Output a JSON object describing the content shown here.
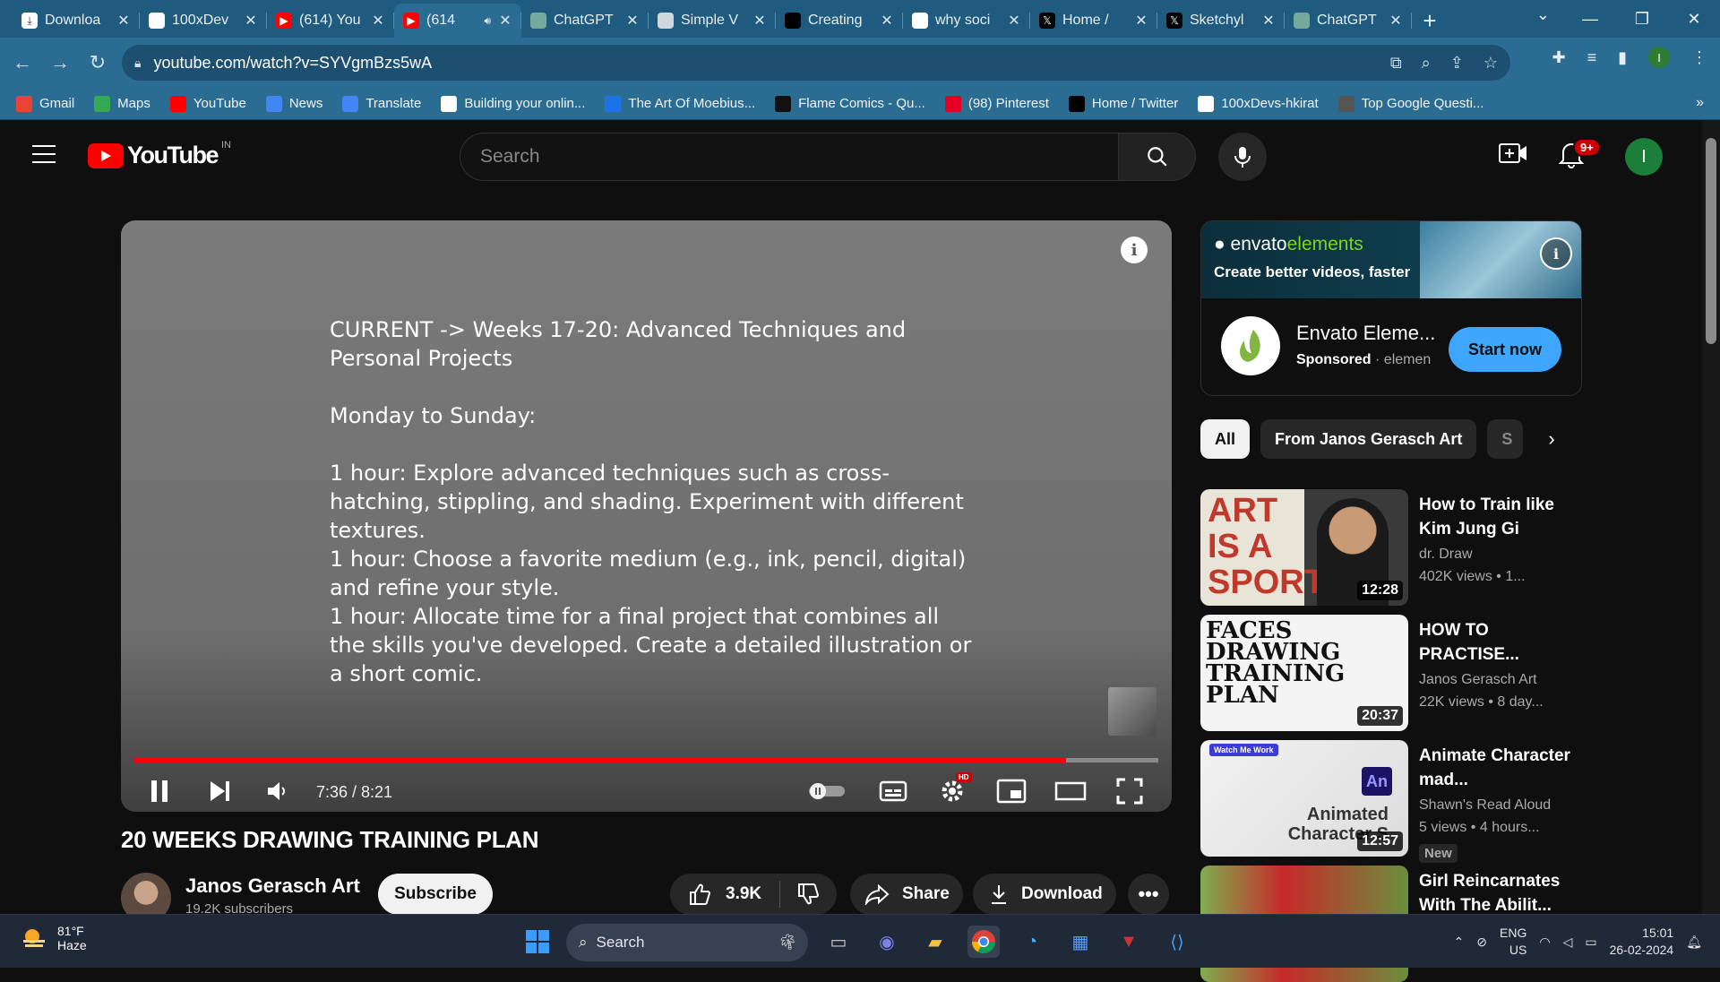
{
  "browser": {
    "tabs": [
      {
        "label": "Downloa",
        "icon": "download-icon"
      },
      {
        "label": "100xDev",
        "icon": "github-icon"
      },
      {
        "label": "(614) You",
        "icon": "youtube-icon"
      },
      {
        "label": "(614",
        "icon": "youtube-icon",
        "active": true
      },
      {
        "label": "ChatGPT",
        "icon": "chatgpt-icon"
      },
      {
        "label": "Simple V",
        "icon": "globe-icon"
      },
      {
        "label": "Creating",
        "icon": "medium-icon"
      },
      {
        "label": "why soci",
        "icon": "google-icon"
      },
      {
        "label": "Home / ",
        "icon": "x-icon"
      },
      {
        "label": "Sketchyl",
        "icon": "x-icon"
      },
      {
        "label": "ChatGPT",
        "icon": "chatgpt-icon"
      }
    ],
    "url": "youtube.com/watch?v=SYVgmBzs5wA",
    "bookmarks": [
      {
        "label": "Gmail",
        "icon": "gmail-icon"
      },
      {
        "label": "Maps",
        "icon": "maps-icon"
      },
      {
        "label": "YouTube",
        "icon": "youtube-icon"
      },
      {
        "label": "News",
        "icon": "news-icon"
      },
      {
        "label": "Translate",
        "icon": "translate-icon"
      },
      {
        "label": "Building your onlin...",
        "icon": "google-icon"
      },
      {
        "label": "The Art Of Moebius...",
        "icon": "shield-icon"
      },
      {
        "label": "Flame Comics - Qu...",
        "icon": "flame-icon"
      },
      {
        "label": "(98) Pinterest",
        "icon": "pinterest-icon"
      },
      {
        "label": "Home / Twitter",
        "icon": "x-icon"
      },
      {
        "label": "100xDevs-hkirat",
        "icon": "github-icon"
      },
      {
        "label": "Top Google Questi...",
        "icon": "bookmark-icon"
      }
    ],
    "bookmarks_more": "»",
    "profile_initial": "I"
  },
  "youtube": {
    "logo_text": "YouTube",
    "country": "IN",
    "search_placeholder": "Search",
    "notif_count": "9+",
    "avatar_initial": "I"
  },
  "player": {
    "slide_text": "CURRENT -> Weeks 17-20: Advanced Techniques and Personal Projects\n\nMonday to Sunday:\n\n1 hour: Explore advanced techniques such as cross-hatching, stippling, and shading. Experiment with different textures.\n1 hour: Choose a favorite medium (e.g., ink, pencil, digital) and refine your style.\n1 hour: Allocate time for a final project that combines all the skills you've developed. Create a detailed illustration or a short comic.",
    "time_display": "7:36 / 8:21",
    "progress_fraction": 0.91,
    "info_icon": "i",
    "hd_badge": "HD"
  },
  "video": {
    "title": "20 WEEKS DRAWING TRAINING PLAN",
    "channel": "Janos Gerasch Art",
    "subscribers": "19.2K subscribers",
    "subscribe_label": "Subscribe",
    "likes": "3.9K",
    "share_label": "Share",
    "download_label": "Download"
  },
  "ad": {
    "brand": "envato",
    "brand_suffix": "elements",
    "tagline": "Create better videos, faster",
    "name": "Envato Eleme...",
    "sponsored": "Sponsored",
    "domain": "· elemen",
    "cta": "Start now"
  },
  "chips": [
    "All",
    "From Janos Gerasch Art",
    "S"
  ],
  "recommendations": [
    {
      "title": "How to Train like Kim Jung Gi",
      "channel": "dr. Draw",
      "meta": "402K views  • 1...",
      "duration": "12:28",
      "thumb_text": "ART IS A SPORT"
    },
    {
      "title": "HOW TO PRACTISE...",
      "channel": "Janos Gerasch Art",
      "meta": "22K views  • 8 day...",
      "duration": "20:37",
      "thumb_text": "FACES DRAWING TRAINING PLAN"
    },
    {
      "title": "Animate Character mad...",
      "channel": "Shawn's Read Aloud",
      "meta": "5 views  • 4 hours...",
      "duration": "12:57",
      "badge": "New",
      "thumb_text": "Animated Character S",
      "thumb_tag": "Watch Me Work",
      "thumb_app": "An"
    },
    {
      "title": "Girl Reincarnates With The Abilit...",
      "channel": "",
      "meta": "",
      "duration": ""
    }
  ],
  "taskbar": {
    "temp": "81°F",
    "condition": "Haze",
    "search_label": "Search",
    "lang": "ENG",
    "region": "US",
    "time": "15:01",
    "date": "26-02-2024"
  }
}
